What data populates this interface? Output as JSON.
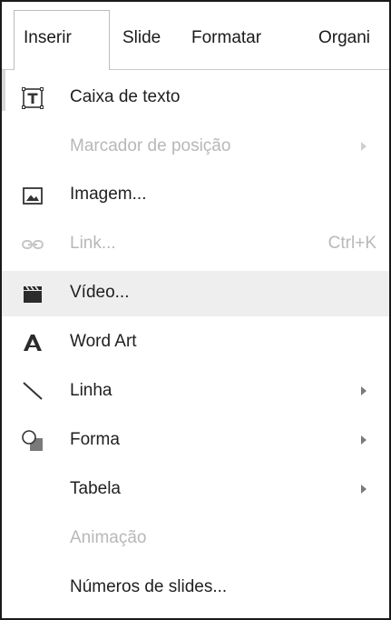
{
  "menubar": {
    "items": [
      {
        "label": "Inserir",
        "active": true
      },
      {
        "label": "Slide"
      },
      {
        "label": "Formatar"
      },
      {
        "label": "Organi"
      }
    ]
  },
  "menu": {
    "items": [
      {
        "label": "Caixa de texto",
        "icon": "text-box-icon",
        "enabled": true
      },
      {
        "label": "Marcador de posição",
        "icon": "",
        "enabled": false,
        "submenu": true
      },
      {
        "label": "Imagem...",
        "icon": "image-icon",
        "enabled": true
      },
      {
        "label": "Link...",
        "icon": "link-icon",
        "enabled": false,
        "shortcut": "Ctrl+K"
      },
      {
        "label": "Vídeo...",
        "icon": "video-icon",
        "enabled": true,
        "highlighted": true
      },
      {
        "label": "Word Art",
        "icon": "word-art-icon",
        "enabled": true
      },
      {
        "label": "Linha",
        "icon": "line-icon",
        "enabled": true,
        "submenu": true
      },
      {
        "label": "Forma",
        "icon": "shape-icon",
        "enabled": true,
        "submenu": true
      },
      {
        "label": "Tabela",
        "icon": "",
        "enabled": true,
        "submenu": true
      },
      {
        "label": "Animação",
        "icon": "",
        "enabled": false
      },
      {
        "label": "Números de slides...",
        "icon": "",
        "enabled": true
      }
    ]
  }
}
